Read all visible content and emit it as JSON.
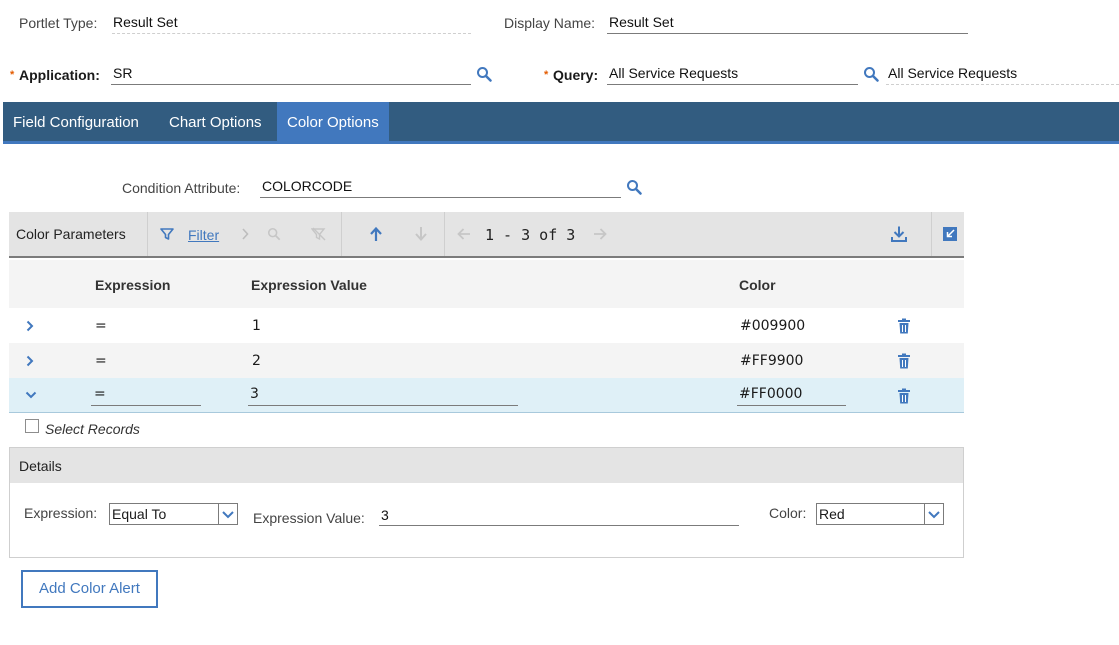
{
  "header": {
    "portlet_type_label": "Portlet Type:",
    "portlet_type_value": "Result Set",
    "display_name_label": "Display Name:",
    "display_name_value": "Result Set",
    "application_label": "Application:",
    "application_value": "SR",
    "query_label": "Query:",
    "query_value": "All Service Requests",
    "query_description": "All Service Requests"
  },
  "tabs": [
    {
      "label": "Field Configuration",
      "active": false
    },
    {
      "label": "Chart Options",
      "active": false
    },
    {
      "label": "Color Options",
      "active": true
    }
  ],
  "condition": {
    "label": "Condition Attribute:",
    "value": "COLORCODE"
  },
  "table": {
    "title": "Color Parameters",
    "filter_label": "Filter",
    "pagination": "1 - 3 of 3",
    "columns": [
      "Expression",
      "Expression Value",
      "Color"
    ],
    "rows": [
      {
        "expression": "=",
        "value": "1",
        "color": "#009900"
      },
      {
        "expression": "=",
        "value": "2",
        "color": "#FF9900"
      },
      {
        "expression": "=",
        "value": "3",
        "color": "#FF0000",
        "expanded": true
      }
    ],
    "select_records_label": "Select Records"
  },
  "details": {
    "title": "Details",
    "expression_label": "Expression:",
    "expression_value": "Equal To",
    "expression_value_label": "Expression Value:",
    "expression_value_value": "3",
    "color_label": "Color:",
    "color_value": "Red"
  },
  "add_button_label": "Add Color Alert",
  "colors": {
    "tab_bar": "#325c80",
    "tab_active": "#4178be",
    "icon_blue": "#4178be",
    "required_star": "#e35b00",
    "selected_row": "#dff0f7"
  }
}
